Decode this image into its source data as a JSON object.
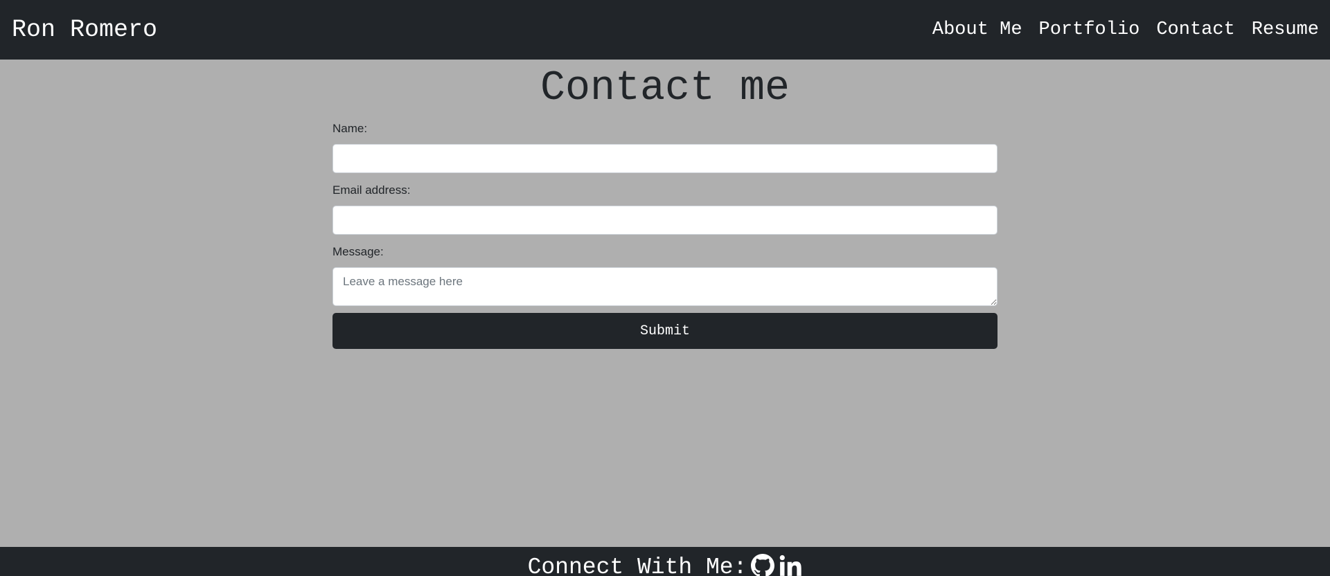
{
  "navbar": {
    "brand": "Ron Romero",
    "links": [
      "About Me",
      "Portfolio",
      "Contact",
      "Resume"
    ]
  },
  "main": {
    "title": "Contact me",
    "form": {
      "name_label": "Name:",
      "name_value": "",
      "email_label": "Email address:",
      "email_value": "",
      "message_label": "Message:",
      "message_placeholder": "Leave a message here",
      "submit_label": "Submit"
    }
  },
  "footer": {
    "text": "Connect With Me:",
    "icons": [
      "github-icon",
      "linkedin-icon"
    ]
  },
  "colors": {
    "background": "#afafaf",
    "navbar": "#212529",
    "text": "#212529",
    "white": "#ffffff"
  }
}
